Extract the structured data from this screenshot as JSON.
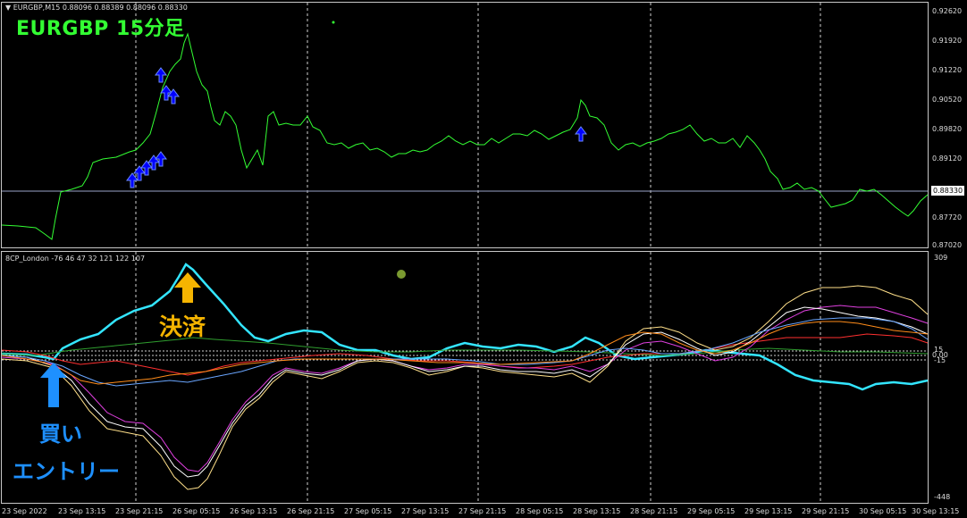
{
  "window": {
    "symbol_line": "EURGBP,M15  0.88096 0.88389 0.88096 0.88330",
    "overlay_title": "EURGBP  15分足"
  },
  "indicator": {
    "label": "8CP_London -76 46 47 32 121 122 107",
    "axis_max": "309",
    "axis_min": "-448",
    "level_high": "15",
    "level_zero": "0.00",
    "level_low": "-15"
  },
  "price_axis": [
    "0.92620",
    "0.91920",
    "0.91220",
    "0.90520",
    "0.89820",
    "0.89120",
    "0.88330",
    "0.87720",
    "0.87020"
  ],
  "current_price": "0.88330",
  "time_axis": [
    "23 Sep 2022",
    "23 Sep 13:15",
    "23 Sep 21:15",
    "26 Sep 05:15",
    "26 Sep 13:15",
    "26 Sep 21:15",
    "27 Sep 05:15",
    "27 Sep 13:15",
    "27 Sep 21:15",
    "28 Sep 05:15",
    "28 Sep 13:15",
    "28 Sep 21:15",
    "29 Sep 05:15",
    "29 Sep 13:15",
    "29 Sep 21:15",
    "30 Sep 05:15",
    "30 Sep 13:15"
  ],
  "annotations": {
    "exit_label": "決済",
    "entry_label_1": "買い",
    "entry_label_2": "エントリー"
  },
  "colors": {
    "price_line": "#33ff33",
    "cyan": "#33e5ff",
    "green_ind": "#2f9e2f",
    "red": "#ff3030",
    "magenta": "#e040e0",
    "yellow": "#ffe08a",
    "white": "#ffffff",
    "blue": "#6aa6ff",
    "orange": "#ff8c1a",
    "arrow_blue": "#0000ff",
    "exit_arrow": "#f5b400",
    "entry_arrow": "#1e90ff"
  }
}
